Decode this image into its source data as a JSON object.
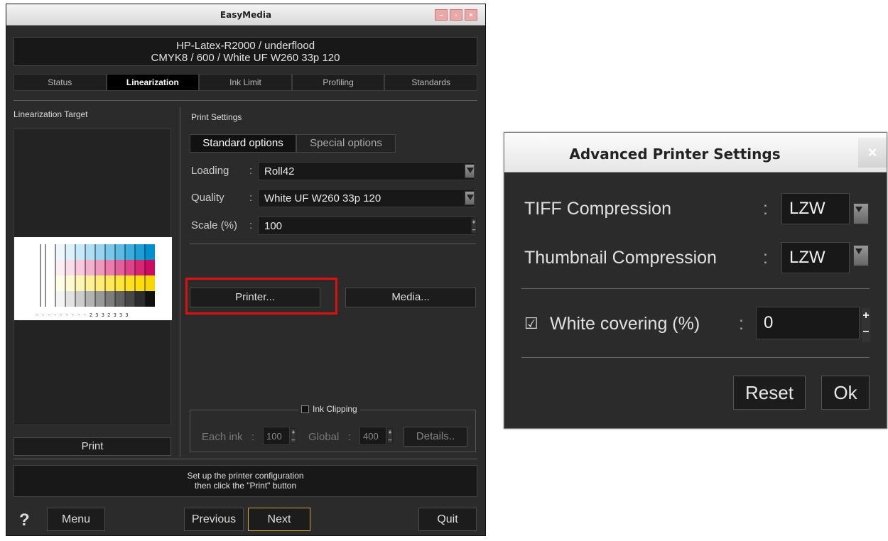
{
  "window": {
    "title": "EasyMedia",
    "controls": {
      "minimize": "–",
      "maximize": "▫",
      "close": "×"
    }
  },
  "header": {
    "line1": "HP-Latex-R2000 / underflood",
    "line2": "CMYK8 / 600 / White UF W260 33p 120"
  },
  "tabs": [
    {
      "label": "Status",
      "active": false
    },
    {
      "label": "Linearization",
      "active": true
    },
    {
      "label": "Ink Limit",
      "active": false
    },
    {
      "label": "Profiling",
      "active": false
    },
    {
      "label": "Standards",
      "active": false
    }
  ],
  "left": {
    "title": "Linearization Target",
    "target_digits": "- - - - - - - -   - 2 3 3 2 3 3 3",
    "print_label": "Print"
  },
  "print_settings": {
    "title": "Print Settings",
    "subtabs": [
      "Standard options",
      "Special options"
    ],
    "loading": {
      "label": "Loading",
      "value": "Roll42"
    },
    "quality": {
      "label": "Quality",
      "value": "White UF W260 33p 120"
    },
    "scale": {
      "label": "Scale (%)",
      "value": "100"
    },
    "separator": ":",
    "printer_button": "Printer...",
    "media_button": "Media...",
    "ink_clipping": {
      "label": "Ink Clipping",
      "each_ink_label": "Each ink",
      "each_ink_value": "100",
      "global_label": "Global",
      "global_value": "400",
      "details_button": "Details.."
    }
  },
  "status_message": {
    "line1": "Set up the printer configuration",
    "line2": "then click the \"Print\" button"
  },
  "footer": {
    "help": "?",
    "menu": "Menu",
    "previous": "Previous",
    "next": "Next",
    "quit": "Quit"
  },
  "dialog": {
    "title": "Advanced Printer Settings",
    "close": "×",
    "tiff": {
      "label": "TIFF Compression",
      "value": "LZW"
    },
    "thumb": {
      "label": "Thumbnail Compression",
      "value": "LZW"
    },
    "separator": ":",
    "white_covering": {
      "label": "White covering (%)",
      "value": "0",
      "checked": true,
      "check_glyph": "☑"
    },
    "reset": "Reset",
    "ok": "Ok"
  },
  "colors": {
    "highlight": "#e01010",
    "accent_border": "#d8a33a",
    "window_bg": "#2b2b2b",
    "field_bg": "#181818"
  }
}
